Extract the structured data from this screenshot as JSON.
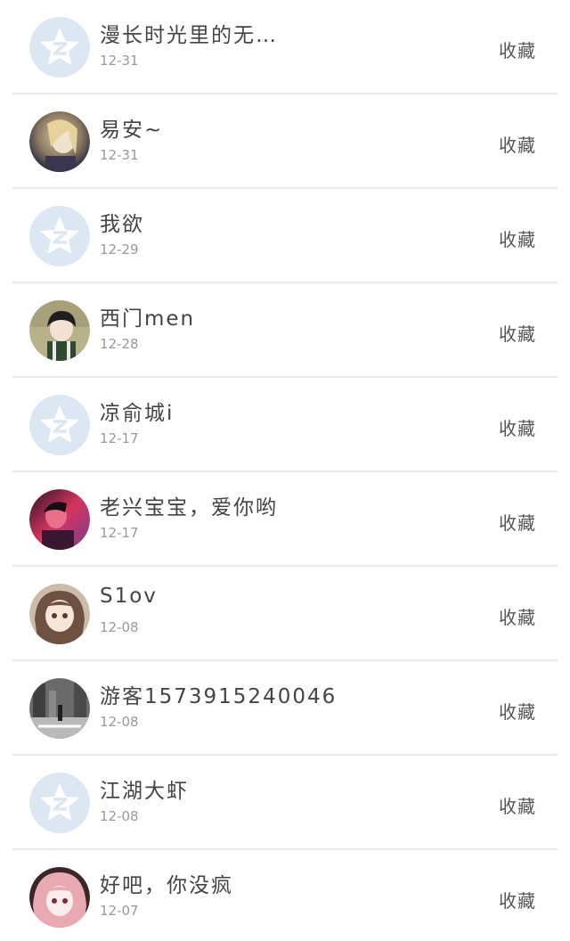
{
  "contacts": [
    {
      "name": "漫长时光里的无…",
      "date": "12-31",
      "action": "收藏",
      "avatar": "default-qq-star"
    },
    {
      "name": "易安~",
      "date": "12-31",
      "action": "收藏",
      "avatar": "photo"
    },
    {
      "name": "我欲",
      "date": "12-29",
      "action": "收藏",
      "avatar": "default-qq-star"
    },
    {
      "name": "西门men",
      "date": "12-28",
      "action": "收藏",
      "avatar": "photo"
    },
    {
      "name": "凉俞城i",
      "date": "12-17",
      "action": "收藏",
      "avatar": "default-qq-star"
    },
    {
      "name": "老兴宝宝，爱你哟",
      "date": "12-17",
      "action": "收藏",
      "avatar": "photo"
    },
    {
      "name": "S1ov",
      "date": "12-08",
      "action": "收藏",
      "avatar": "photo"
    },
    {
      "name": "游客1573915240046",
      "date": "12-08",
      "action": "收藏",
      "avatar": "photo"
    },
    {
      "name": "江湖大虾",
      "date": "12-08",
      "action": "收藏",
      "avatar": "default-qq-star"
    },
    {
      "name": "好吧，你没疯",
      "date": "12-07",
      "action": "收藏",
      "avatar": "photo"
    }
  ],
  "colors": {
    "default_avatar_bg": "#dde7f3",
    "default_avatar_star": "#ffffff",
    "divider": "#e9e9e9",
    "name_text": "#444444",
    "date_text": "#9a9a9a"
  }
}
